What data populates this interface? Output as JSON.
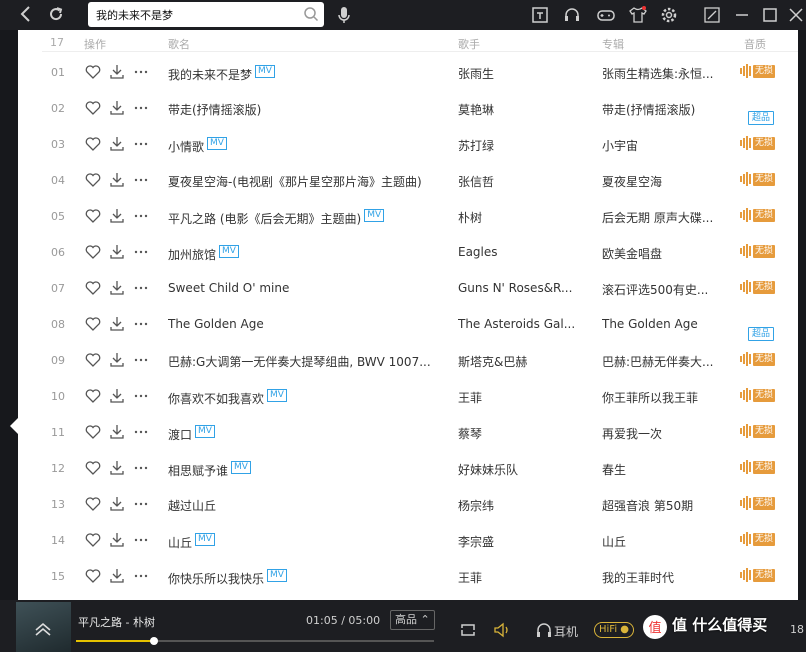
{
  "search": {
    "value": "我的未来不是梦"
  },
  "header": {
    "index": "17",
    "ops": "操作",
    "title": "歌名",
    "artist": "歌手",
    "album": "专辑",
    "quality": "音质"
  },
  "rows": [
    {
      "index": "01",
      "title": "我的未来不是梦",
      "mv": "MV",
      "artist": "张雨生",
      "album": "张雨生精选集:永恒...",
      "quality": "lossless"
    },
    {
      "index": "02",
      "title": "带走(抒情摇滚版)",
      "mv": "",
      "artist": "莫艳琳",
      "album": "带走(抒情摇滚版)",
      "quality": "super"
    },
    {
      "index": "03",
      "title": "小情歌",
      "mv": "MV",
      "artist": "苏打绿",
      "album": "小宇宙",
      "quality": "lossless"
    },
    {
      "index": "04",
      "title": "夏夜星空海-(电视剧《那片星空那片海》主题曲)",
      "mv": "",
      "artist": "张信哲",
      "album": "夏夜星空海",
      "quality": "lossless"
    },
    {
      "index": "05",
      "title": "平凡之路 (电影《后会无期》主题曲)",
      "mv": "MV",
      "artist": "朴树",
      "album": "后会无期 原声大碟...",
      "quality": "lossless"
    },
    {
      "index": "06",
      "title": "加州旅馆",
      "mv": "MV",
      "artist": "Eagles",
      "album": "欧美金唱盘",
      "quality": "lossless"
    },
    {
      "index": "07",
      "title": "Sweet Child O' mine",
      "mv": "",
      "artist": "Guns N' Roses&R...",
      "album": "滚石评选500有史...",
      "quality": "lossless"
    },
    {
      "index": "08",
      "title": "The Golden Age",
      "mv": "",
      "artist": "The Asteroids Gal...",
      "album": "The Golden Age",
      "quality": "super"
    },
    {
      "index": "09",
      "title": "巴赫:G大调第一无伴奏大提琴组曲, BWV 1007...",
      "mv": "",
      "artist": "斯塔克&巴赫",
      "album": "巴赫:巴赫无伴奏大...",
      "quality": "lossless"
    },
    {
      "index": "10",
      "title": "你喜欢不如我喜欢",
      "mv": "MV",
      "artist": "王菲",
      "album": "你王菲所以我王菲",
      "quality": "lossless"
    },
    {
      "index": "11",
      "title": "渡口",
      "mv": "MV",
      "artist": "蔡琴",
      "album": "再爱我一次",
      "quality": "lossless"
    },
    {
      "index": "12",
      "title": "相思赋予谁",
      "mv": "MV",
      "artist": "好妹妹乐队",
      "album": "春生",
      "quality": "lossless"
    },
    {
      "index": "13",
      "title": "越过山丘",
      "mv": "",
      "artist": "杨宗纬",
      "album": "超强音浪 第50期",
      "quality": "lossless"
    },
    {
      "index": "14",
      "title": "山丘",
      "mv": "MV",
      "artist": "李宗盛",
      "album": "山丘",
      "quality": "lossless"
    },
    {
      "index": "15",
      "title": "你快乐所以我快乐",
      "mv": "MV",
      "artist": "王菲",
      "album": "我的王菲时代",
      "quality": "lossless"
    }
  ],
  "badges": {
    "lossless": "无损",
    "super": "超品"
  },
  "player": {
    "title": "平凡之路 - 朴树",
    "time": "01:05 / 05:00",
    "progress": 0.217,
    "quality": "高品 ⌃",
    "earphone": "耳机",
    "hifi": "HiFi ●",
    "watermark": "值 什么值得买",
    "count": "18"
  },
  "colors": {
    "accent": "#e69b3c",
    "blue": "#31a2e6",
    "bar": "#1d1e22"
  }
}
